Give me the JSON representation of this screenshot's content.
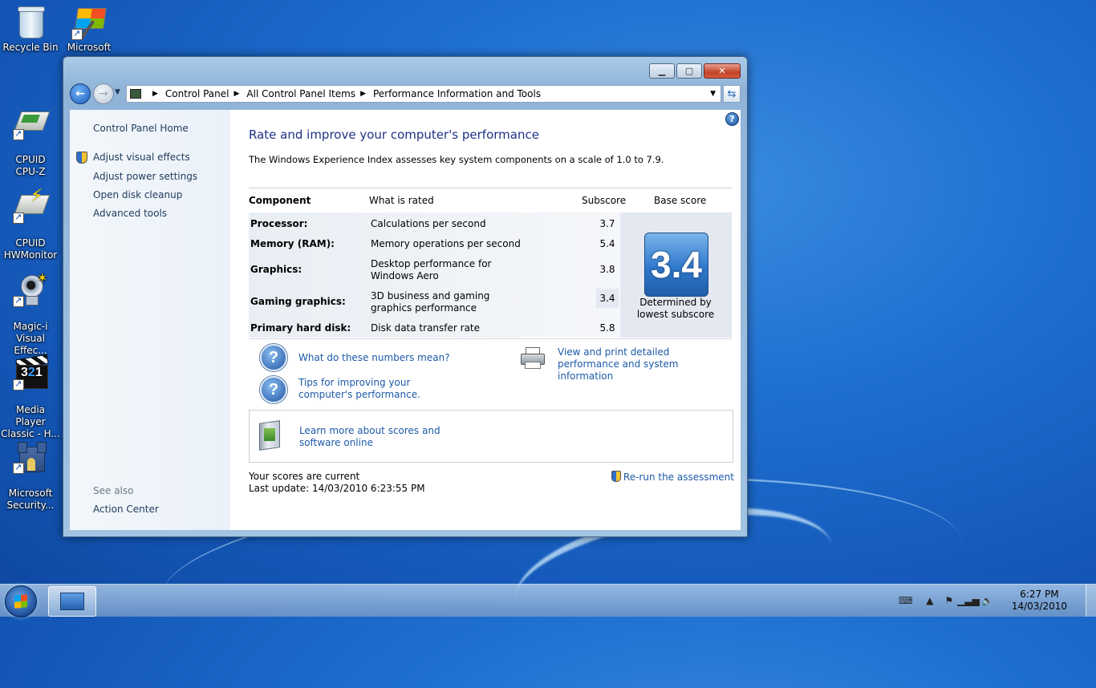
{
  "desktop": {
    "icons": [
      {
        "label": "Recycle Bin"
      },
      {
        "label": "Microsoft"
      },
      {
        "label": "CPUID\nCPU-Z"
      },
      {
        "label": "CPUID\nHWMonitor"
      },
      {
        "label": "Magic-i\nVisual Effec..."
      },
      {
        "label": "Media Player\nClassic - H..."
      },
      {
        "label": "Microsoft\nSecurity..."
      }
    ]
  },
  "window": {
    "breadcrumb": [
      "Control Panel",
      "All Control Panel Items",
      "Performance Information and Tools"
    ],
    "sidebar": {
      "home": "Control Panel Home",
      "links": [
        "Adjust visual effects",
        "Adjust power settings",
        "Open disk cleanup",
        "Advanced tools"
      ],
      "see_also": "See also",
      "action_center": "Action Center"
    },
    "main": {
      "title": "Rate and improve your computer's performance",
      "description": "The Windows Experience Index assesses key system components on a scale of 1.0 to 7.9.",
      "columns": {
        "component": "Component",
        "what": "What is rated",
        "subscore": "Subscore",
        "base": "Base score"
      },
      "rows": [
        {
          "component": "Processor:",
          "what": "Calculations per second",
          "subscore": "3.7"
        },
        {
          "component": "Memory (RAM):",
          "what": "Memory operations per second",
          "subscore": "5.4"
        },
        {
          "component": "Graphics:",
          "what": "Desktop performance for Windows Aero",
          "subscore": "3.8"
        },
        {
          "component": "Gaming graphics:",
          "what": "3D business and gaming graphics performance",
          "subscore": "3.4"
        },
        {
          "component": "Primary hard disk:",
          "what": "Disk data transfer rate",
          "subscore": "5.8"
        }
      ],
      "base_score": "3.4",
      "base_caption": "Determined by lowest subscore",
      "links": {
        "numbers": "What do these numbers mean?",
        "tips": "Tips for improving your computer's performance.",
        "print": "View and print detailed performance and system information",
        "learn": "Learn more about scores and software online"
      },
      "status_line1": "Your scores are current",
      "status_line2": "Last update: 14/03/2010 6:23:55 PM",
      "rerun": "Re-run the assessment"
    }
  },
  "taskbar": {
    "time": "6:27 PM",
    "date": "14/03/2010"
  },
  "colors": {
    "link": "#1c5aa8",
    "title": "#1e3287",
    "sidebar_text": "#1e395b"
  }
}
